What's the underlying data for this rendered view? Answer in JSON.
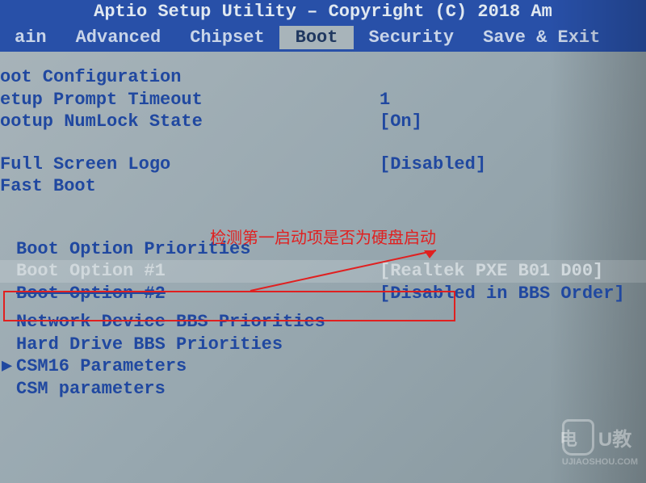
{
  "header": {
    "title": "Aptio Setup Utility – Copyright (C) 2018 Am"
  },
  "menu": {
    "items": [
      "ain",
      "Advanced",
      "Chipset",
      "Boot",
      "Security",
      "Save & Exit"
    ],
    "active_index": 3
  },
  "sections": {
    "boot_config": {
      "header": "oot Configuration",
      "setup_prompt": {
        "label": "etup Prompt Timeout",
        "value": "1"
      },
      "numlock": {
        "label": "ootup NumLock State",
        "value": "[On]"
      }
    },
    "display": {
      "full_screen": {
        "label": "Full Screen Logo",
        "value": "[Disabled]"
      },
      "fast_boot": {
        "label": "Fast Boot",
        "value": ""
      }
    },
    "boot_priorities": {
      "header": "Boot Option Priorities",
      "option1": {
        "label": "Boot Option #1",
        "value": "[Realtek PXE B01 D00]"
      },
      "option2": {
        "label": "Boot Option #2",
        "value": "[Disabled in BBS Order]"
      }
    },
    "other": {
      "network_bbs": "Network Device BBS Priorities",
      "hdd_bbs": "Hard Drive BBS Priorities",
      "csm16": "CSM16 Parameters",
      "csm": "CSM parameters"
    }
  },
  "annotation": {
    "text": "检测第一启动项是否为硬盘启动"
  },
  "watermark": {
    "brand1": "电",
    "brand2": "U教",
    "url": "UJIAOSHOU.COM"
  }
}
